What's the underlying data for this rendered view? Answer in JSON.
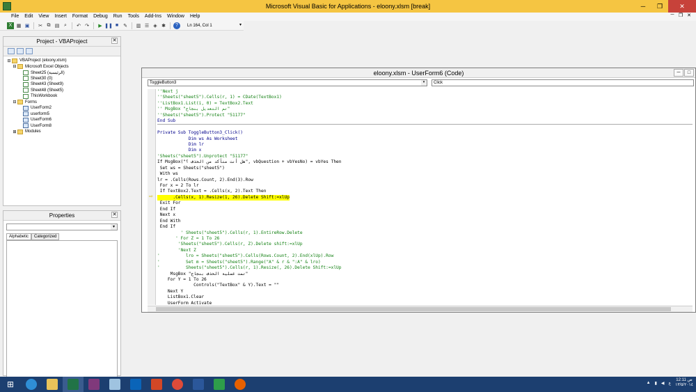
{
  "window": {
    "title": "Microsoft Visual Basic for Applications - eloony.xlsm [break]"
  },
  "menu": [
    "File",
    "Edit",
    "View",
    "Insert",
    "Format",
    "Debug",
    "Run",
    "Tools",
    "Add-Ins",
    "Window",
    "Help"
  ],
  "toolbar": {
    "position": "Ln 164, Col 1"
  },
  "project": {
    "title": "Project - VBAProject",
    "tree": [
      {
        "level": 0,
        "exp": "⊟",
        "icon": "folder",
        "label": "VBAProject (eloony.xlsm)"
      },
      {
        "level": 1,
        "exp": "⊟",
        "icon": "folder",
        "label": "Microsoft Excel Objects"
      },
      {
        "level": 2,
        "exp": "",
        "icon": "sheet",
        "label": "Sheet25 (الرئيسية)"
      },
      {
        "level": 2,
        "exp": "",
        "icon": "sheet",
        "label": "Sheet30 (0)"
      },
      {
        "level": 2,
        "exp": "",
        "icon": "sheet",
        "label": "Sheet43 (Sheet9)"
      },
      {
        "level": 2,
        "exp": "",
        "icon": "sheet",
        "label": "Sheet48 (Sheet5)"
      },
      {
        "level": 2,
        "exp": "",
        "icon": "sheet",
        "label": "ThisWorkbook"
      },
      {
        "level": 1,
        "exp": "⊟",
        "icon": "folder",
        "label": "Forms"
      },
      {
        "level": 2,
        "exp": "",
        "icon": "form",
        "label": "UserForm2"
      },
      {
        "level": 2,
        "exp": "",
        "icon": "form",
        "label": "userform5"
      },
      {
        "level": 2,
        "exp": "",
        "icon": "form",
        "label": "UserForm6"
      },
      {
        "level": 2,
        "exp": "",
        "icon": "form",
        "label": "UserForm8"
      },
      {
        "level": 1,
        "exp": "⊞",
        "icon": "folder",
        "label": "Modules"
      }
    ]
  },
  "properties": {
    "title": "Properties",
    "tab_alphabetic": "Alphabetic",
    "tab_categorized": "Categorized"
  },
  "code_window": {
    "title": "eloony.xlsm - UserForm6 (Code)",
    "object": "ToggleButton3",
    "procedure": "Click",
    "lines": [
      {
        "t": "''Next j",
        "c": "cm"
      },
      {
        "t": "''Sheets(\"sheet5\").Cells(r, 1) = CDate(TextBox1)",
        "c": "cm"
      },
      {
        "t": "''ListBox1.List(i, 0) = TextBox2.Text",
        "c": "cm"
      },
      {
        "t": "'' MsgBox \"تم التعديل بنجاح\"",
        "c": "cm"
      },
      {
        "t": "''Sheets(\"sheet5\").Protect \"51177\"",
        "c": "cm"
      },
      {
        "t": "End Sub",
        "c": "kw sep"
      },
      {
        "t": "",
        "c": ""
      },
      {
        "t": "Private Sub ToggleButton3_Click()",
        "c": "kw"
      },
      {
        "t": "            Dim ws As Worksheet",
        "c": "kw"
      },
      {
        "t": "            Dim lr",
        "c": "kw"
      },
      {
        "t": "            Dim x",
        "c": "kw"
      },
      {
        "t": "'Sheets(\"sheet5\").Unprotect \"51177\"",
        "c": "cm"
      },
      {
        "t": "If MsgBox(\"هل أنت متأكد من الحذف ؟\", vbQuestion + vbYesNo) = vbYes Then",
        "c": ""
      },
      {
        "t": " Set ws = Sheets(\"sheet5\")",
        "c": ""
      },
      {
        "t": " With ws",
        "c": ""
      },
      {
        "t": "lr = .Cells(Rows.Count, 2).End(3).Row",
        "c": ""
      },
      {
        "t": " For x = 2 To lr",
        "c": ""
      },
      {
        "t": " If TextBox2.Text = .Cells(x, 2).Text Then",
        "c": ""
      },
      {
        "t": "      .Cells(x, 1).Resize(1, 26).Delete Shift:=xlUp",
        "c": "hl"
      },
      {
        "t": " Exit For",
        "c": ""
      },
      {
        "t": " End If",
        "c": ""
      },
      {
        "t": " Next x",
        "c": ""
      },
      {
        "t": " End With",
        "c": ""
      },
      {
        "t": " End If",
        "c": ""
      },
      {
        "t": "         ' Sheets(\"sheet5\").Cells(r, 1).EntireRow.Delete",
        "c": "cm"
      },
      {
        "t": "       ' For Z = 1 To 26",
        "c": "cm"
      },
      {
        "t": "        'Sheets(\"sheet5\").Cells(r, Z).Delete shift:=xlUp",
        "c": "cm"
      },
      {
        "t": "        'Next Z",
        "c": "cm"
      },
      {
        "t": "'          lro = Sheets(\"sheet5\").Cells(Rows.Count, 2).End(xlUp).Row",
        "c": "cm"
      },
      {
        "t": "'          Set m = Sheets(\"sheet5\").Range(\"A\" & r & \":A\" & lro)",
        "c": "cm"
      },
      {
        "t": "'          Sheets(\"sheet5\").Cells(r, 1).Resize(, 26).Delete Shift:=xlUp",
        "c": "cm"
      },
      {
        "t": "     MsgBox \"تمت عملية الحذف بنجاح\"",
        "c": ""
      },
      {
        "t": "    For Y = 1 To 26",
        "c": ""
      },
      {
        "t": "              Controls(\"TextBox\" & Y).Text = \"\"",
        "c": ""
      },
      {
        "t": "    Next Y",
        "c": ""
      },
      {
        "t": "    ListBox1.Clear",
        "c": ""
      },
      {
        "t": "    UserForm_Activate",
        "c": ""
      }
    ]
  },
  "taskbar": {
    "clock_time": "12:11 ص",
    "clock_date": "١٣/٥/٢٠١٤",
    "lang": "ع"
  }
}
